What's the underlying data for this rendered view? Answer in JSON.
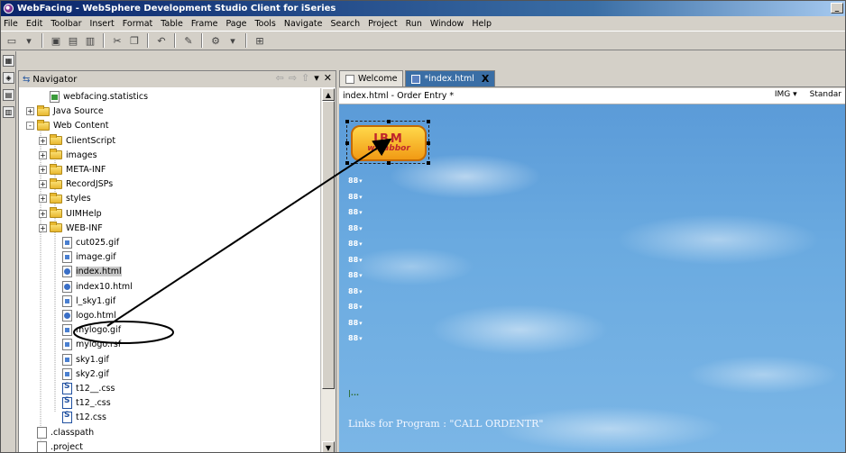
{
  "window": {
    "title": "WebFacing - WebSphere Development Studio Client for iSeries",
    "minimize_glyph": "_"
  },
  "menubar": {
    "items": [
      "File",
      "Edit",
      "Toolbar",
      "Insert",
      "Format",
      "Table",
      "Frame",
      "Page",
      "Tools",
      "Navigate",
      "Search",
      "Project",
      "Run",
      "Window",
      "Help"
    ]
  },
  "navigator": {
    "title": "Navigator",
    "items": [
      {
        "label": "webfacing.statistics",
        "type": "file-stat",
        "depth": 3,
        "expander": ""
      },
      {
        "label": "Java Source",
        "type": "folder",
        "depth": 2,
        "expander": "+"
      },
      {
        "label": "Web Content",
        "type": "folder",
        "depth": 2,
        "expander": "-"
      },
      {
        "label": "ClientScript",
        "type": "folder",
        "depth": 3,
        "expander": "+"
      },
      {
        "label": "images",
        "type": "folder",
        "depth": 3,
        "expander": "+"
      },
      {
        "label": "META-INF",
        "type": "folder",
        "depth": 3,
        "expander": "+"
      },
      {
        "label": "RecordJSPs",
        "type": "folder",
        "depth": 3,
        "expander": "+"
      },
      {
        "label": "styles",
        "type": "folder",
        "depth": 3,
        "expander": "+"
      },
      {
        "label": "UIMHelp",
        "type": "folder",
        "depth": 3,
        "expander": "+"
      },
      {
        "label": "WEB-INF",
        "type": "folder",
        "depth": 3,
        "expander": "+"
      },
      {
        "label": "cut025.gif",
        "type": "gif",
        "depth": 4,
        "expander": ""
      },
      {
        "label": "image.gif",
        "type": "gif",
        "depth": 4,
        "expander": ""
      },
      {
        "label": "index.html",
        "type": "html",
        "depth": 4,
        "expander": "",
        "selected": true
      },
      {
        "label": "index10.html",
        "type": "html",
        "depth": 4,
        "expander": ""
      },
      {
        "label": "l_sky1.gif",
        "type": "gif",
        "depth": 4,
        "expander": ""
      },
      {
        "label": "logo.html",
        "type": "html",
        "depth": 4,
        "expander": ""
      },
      {
        "label": "mylogo.gif",
        "type": "gif",
        "depth": 4,
        "expander": "",
        "circled": true
      },
      {
        "label": "mylogo.rsf",
        "type": "gif",
        "depth": 4,
        "expander": ""
      },
      {
        "label": "sky1.gif",
        "type": "gif",
        "depth": 4,
        "expander": ""
      },
      {
        "label": "sky2.gif",
        "type": "gif",
        "depth": 4,
        "expander": ""
      },
      {
        "label": "t12__.css",
        "type": "css",
        "depth": 4,
        "expander": ""
      },
      {
        "label": "t12_.css",
        "type": "css",
        "depth": 4,
        "expander": ""
      },
      {
        "label": "t12.css",
        "type": "css",
        "depth": 4,
        "expander": ""
      },
      {
        "label": ".classpath",
        "type": "file",
        "depth": 2,
        "expander": ""
      },
      {
        "label": ".project",
        "type": "file",
        "depth": 2,
        "expander": ""
      }
    ]
  },
  "editor": {
    "tabs": [
      {
        "label": "Welcome",
        "active": false
      },
      {
        "label": "*index.html",
        "active": true
      }
    ],
    "tab_close_glyph": "X",
    "header_title": "index.html - Order Entry *",
    "header_right": [
      "IMG",
      "Standar"
    ],
    "logo_line1": "IBM",
    "logo_line2": "wfLabbor",
    "field_tags": [
      "88",
      "88",
      "88",
      "88",
      "88",
      "88",
      "88",
      "88",
      "88",
      "88",
      "88"
    ],
    "small_mark": "|...",
    "link_text": "Links for Program : \"CALL ORDENTR\""
  },
  "icons": {
    "scroll_up": "▲",
    "scroll_down": "▼"
  }
}
